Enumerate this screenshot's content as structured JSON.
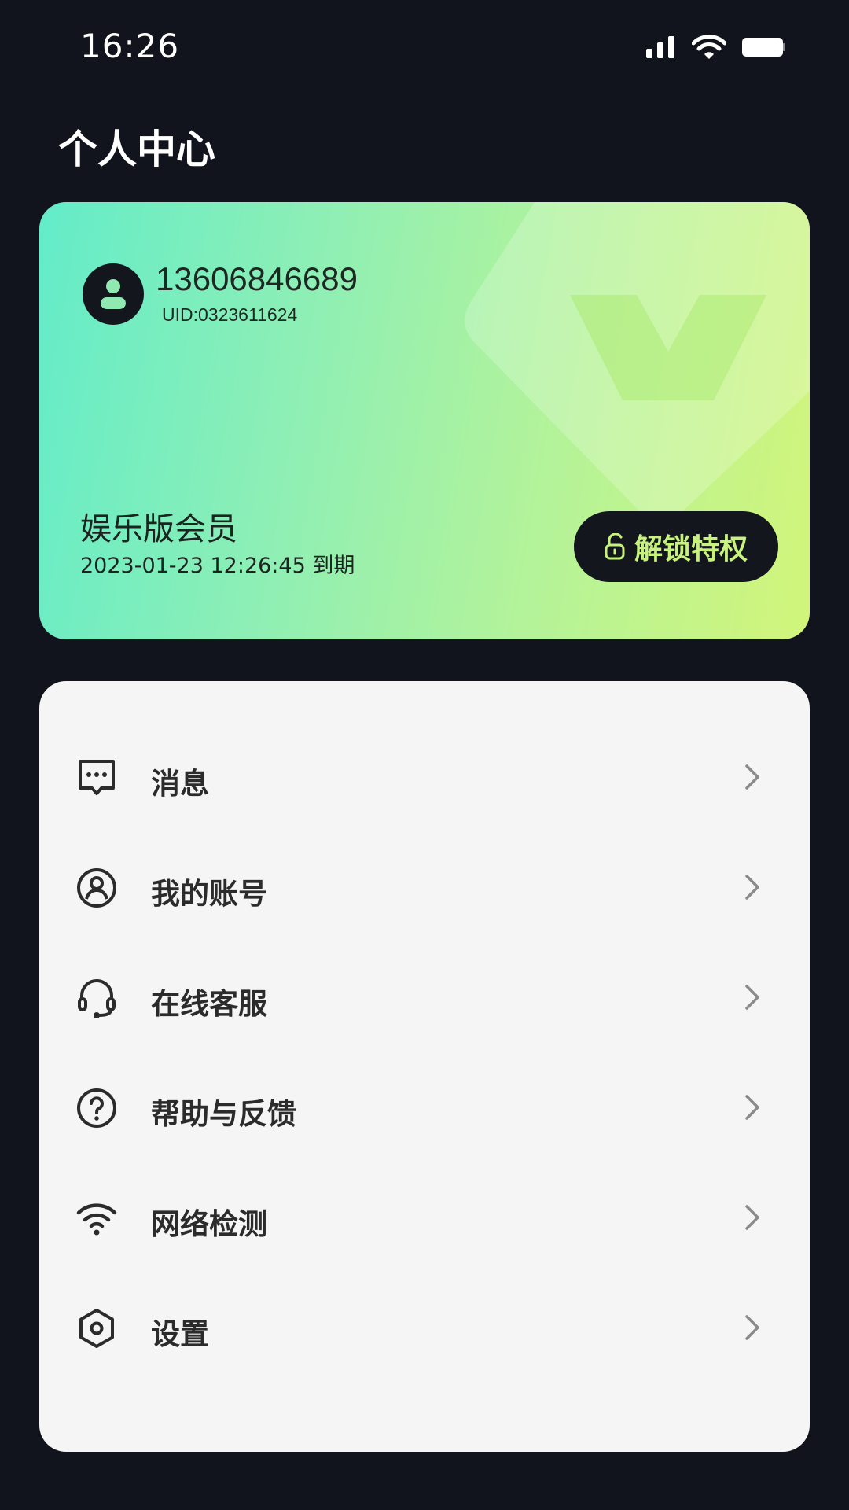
{
  "status_bar": {
    "time": "16:26",
    "icons": [
      "signal-icon",
      "wifi-icon",
      "battery-icon"
    ]
  },
  "header": {
    "title": "个人中心"
  },
  "member_card": {
    "phone": "13606846689",
    "uid": "UID:0323611624",
    "tier": "娱乐版会员",
    "expire": "2023-01-23 12:26:45 到期",
    "unlock_label": "解锁特权",
    "icons": [
      "user-icon",
      "unlock-icon"
    ],
    "colors": {
      "gradient_start": "#63ecc9",
      "gradient_end": "#d2f57a",
      "button_bg": "#13161d",
      "button_text": "#c8f27e"
    }
  },
  "menu": {
    "items": [
      {
        "label": "消息",
        "icon": "message-icon"
      },
      {
        "label": "我的账号",
        "icon": "account-icon"
      },
      {
        "label": "在线客服",
        "icon": "headset-icon"
      },
      {
        "label": "帮助与反馈",
        "icon": "help-icon"
      },
      {
        "label": "网络检测",
        "icon": "wifi-icon"
      },
      {
        "label": "设置",
        "icon": "settings-icon"
      }
    ]
  },
  "colors": {
    "background": "#11141c",
    "menu_background": "#f5f5f5"
  }
}
